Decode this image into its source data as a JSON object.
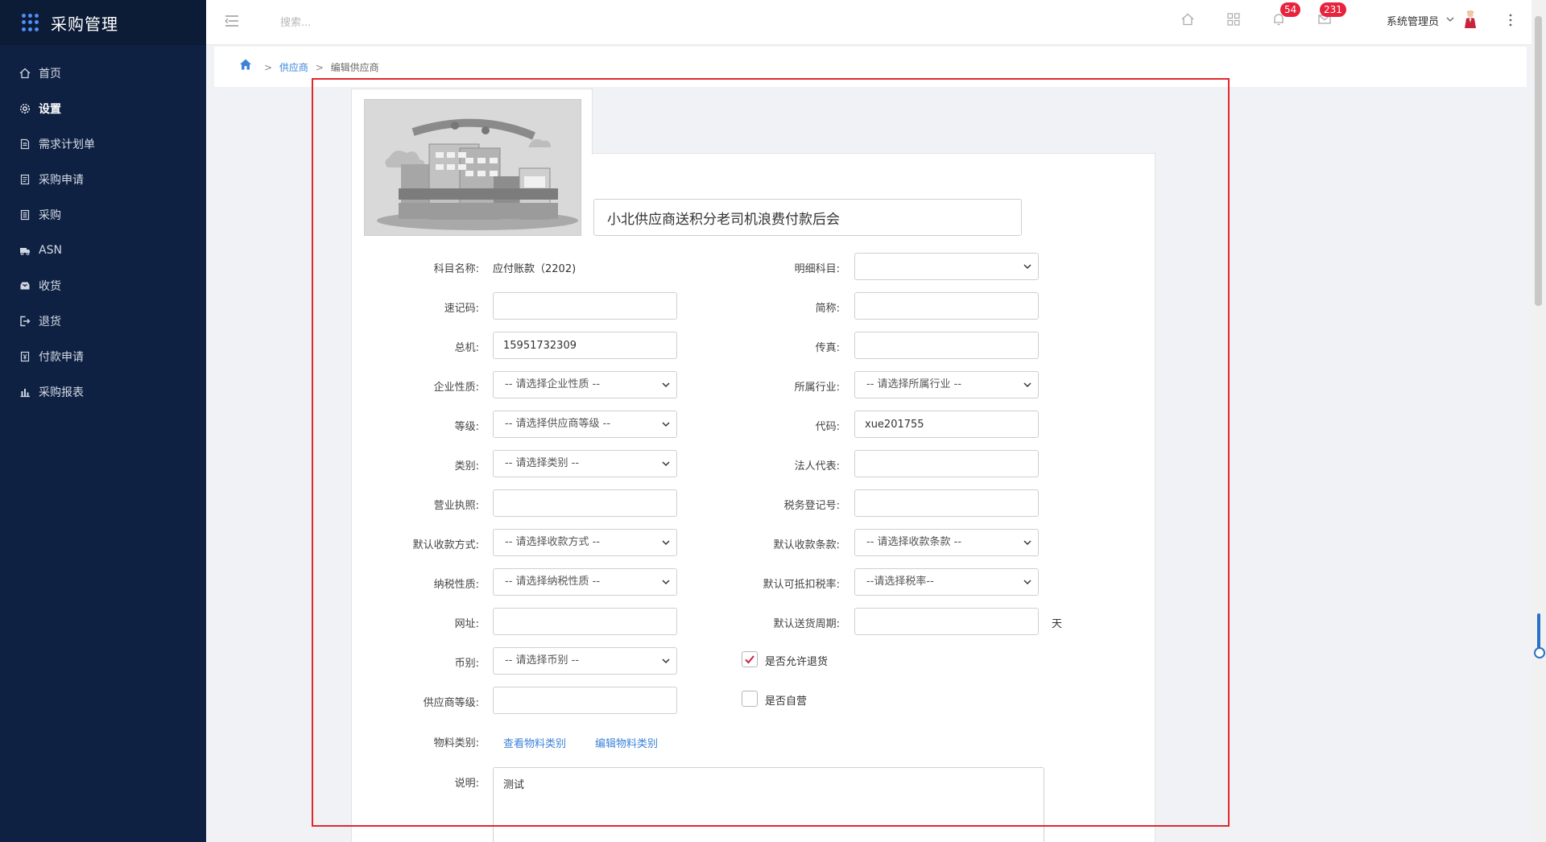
{
  "app": {
    "title": "采购管理"
  },
  "sidebar": {
    "items": [
      {
        "label": "首页",
        "icon": "home-icon"
      },
      {
        "label": "设置",
        "icon": "gear-icon",
        "active": true
      },
      {
        "label": "需求计划单",
        "icon": "document-icon"
      },
      {
        "label": "采购申请",
        "icon": "form-icon"
      },
      {
        "label": "采购",
        "icon": "list-icon"
      },
      {
        "label": "ASN",
        "icon": "truck-icon"
      },
      {
        "label": "收货",
        "icon": "inbox-icon"
      },
      {
        "label": "退货",
        "icon": "return-icon"
      },
      {
        "label": "付款申请",
        "icon": "payment-icon"
      },
      {
        "label": "采购报表",
        "icon": "bar-chart-icon"
      }
    ]
  },
  "header": {
    "search_placeholder": "搜索...",
    "notifications_count": "54",
    "messages_count": "231",
    "user_name": "系统管理员"
  },
  "breadcrumb": {
    "link": "供应商",
    "current": "编辑供应商",
    "sep": ">"
  },
  "form": {
    "supplier_name": "小北供应商送积分老司机浪费付款后会",
    "subject_name_label": "科目名称:",
    "subject_name_value": "应付账款（2202)",
    "detail_subject_label": "明细科目:",
    "mnemonic_label": "速记码:",
    "short_name_label": "简称:",
    "switchboard_label": "总机:",
    "switchboard_value": "15951732309",
    "fax_label": "传真:",
    "enterprise_type_label": "企业性质:",
    "enterprise_type_value": "-- 请选择企业性质 --",
    "industry_label": "所属行业:",
    "industry_value": "-- 请选择所属行业 --",
    "grade_label": "等级:",
    "grade_value": "-- 请选择供应商等级 --",
    "code_label": "代码:",
    "code_value": "xue201755",
    "category_label": "类别:",
    "category_value": "-- 请选择类别 --",
    "legal_rep_label": "法人代表:",
    "license_label": "营业执照:",
    "tax_reg_label": "税务登记号:",
    "payment_method_label": "默认收款方式:",
    "payment_method_value": "-- 请选择收款方式 --",
    "payment_terms_label": "默认收款条款:",
    "payment_terms_value": "-- 请选择收款条款 --",
    "tax_nature_label": "纳税性质:",
    "tax_nature_value": "-- 请选择纳税性质 --",
    "deduct_rate_label": "默认可抵扣税率:",
    "deduct_rate_value": "--请选择税率--",
    "website_label": "网址:",
    "delivery_cycle_label": "默认送货周期:",
    "delivery_unit": "天",
    "currency_label": "币别:",
    "currency_value": "-- 请选择币别 --",
    "allow_return_label": "是否允许退货",
    "allow_return_checked": true,
    "supplier_level_label": "供应商等级:",
    "self_operated_label": "是否自营",
    "self_operated_checked": false,
    "material_category_label": "物料类别:",
    "view_material_link": "查看物料类别",
    "edit_material_link": "编辑物料类别",
    "remark_label": "说明:",
    "remark_value": "测试"
  },
  "colors": {
    "sidebar_bg": "#0f2142",
    "accent": "#3b83d8",
    "badge": "#e8243c",
    "highlight": "#e3262e"
  }
}
